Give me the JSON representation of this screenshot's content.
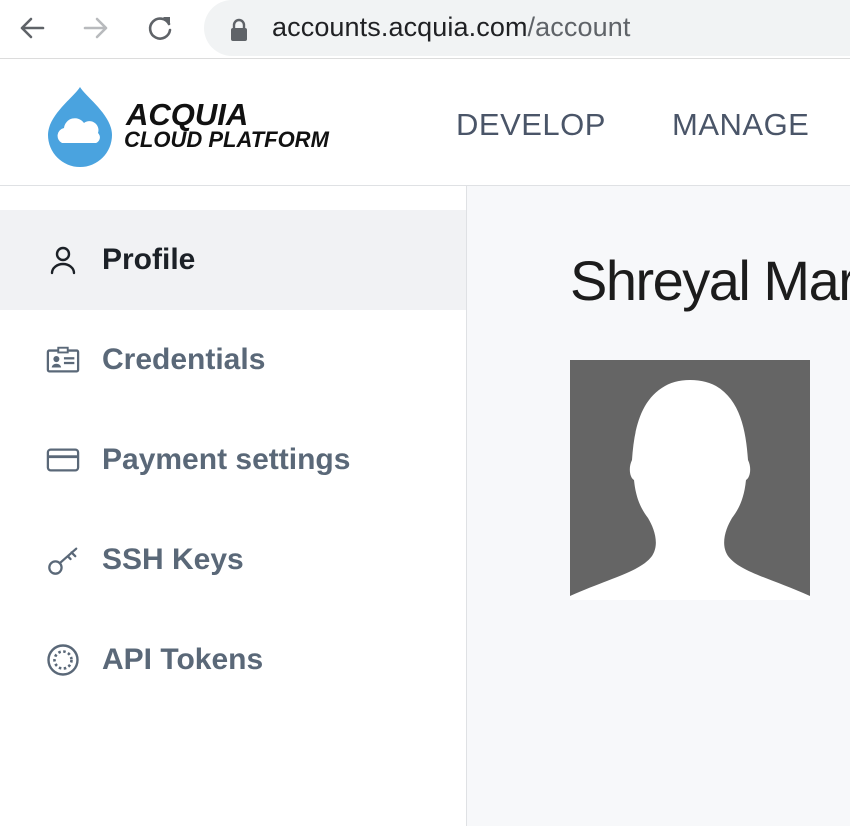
{
  "browser": {
    "url_host": "accounts.acquia.com",
    "url_path": "/account"
  },
  "header": {
    "brand_line1": "ACQUIA",
    "brand_line2": "CLOUD PLATFORM",
    "nav": [
      {
        "label": "DEVELOP"
      },
      {
        "label": "MANAGE"
      }
    ]
  },
  "sidebar": {
    "items": [
      {
        "label": "Profile",
        "icon": "user-icon",
        "active": true
      },
      {
        "label": "Credentials",
        "icon": "id-card-icon",
        "active": false
      },
      {
        "label": "Payment settings",
        "icon": "credit-card-icon",
        "active": false
      },
      {
        "label": "SSH Keys",
        "icon": "key-icon",
        "active": false
      },
      {
        "label": "API Tokens",
        "icon": "token-icon",
        "active": false
      }
    ]
  },
  "main": {
    "profile_name": "Shreyal Mar"
  },
  "colors": {
    "accent_drop": "#4aa3df",
    "active_bg": "#f1f2f4",
    "label_muted": "#5a6878"
  }
}
